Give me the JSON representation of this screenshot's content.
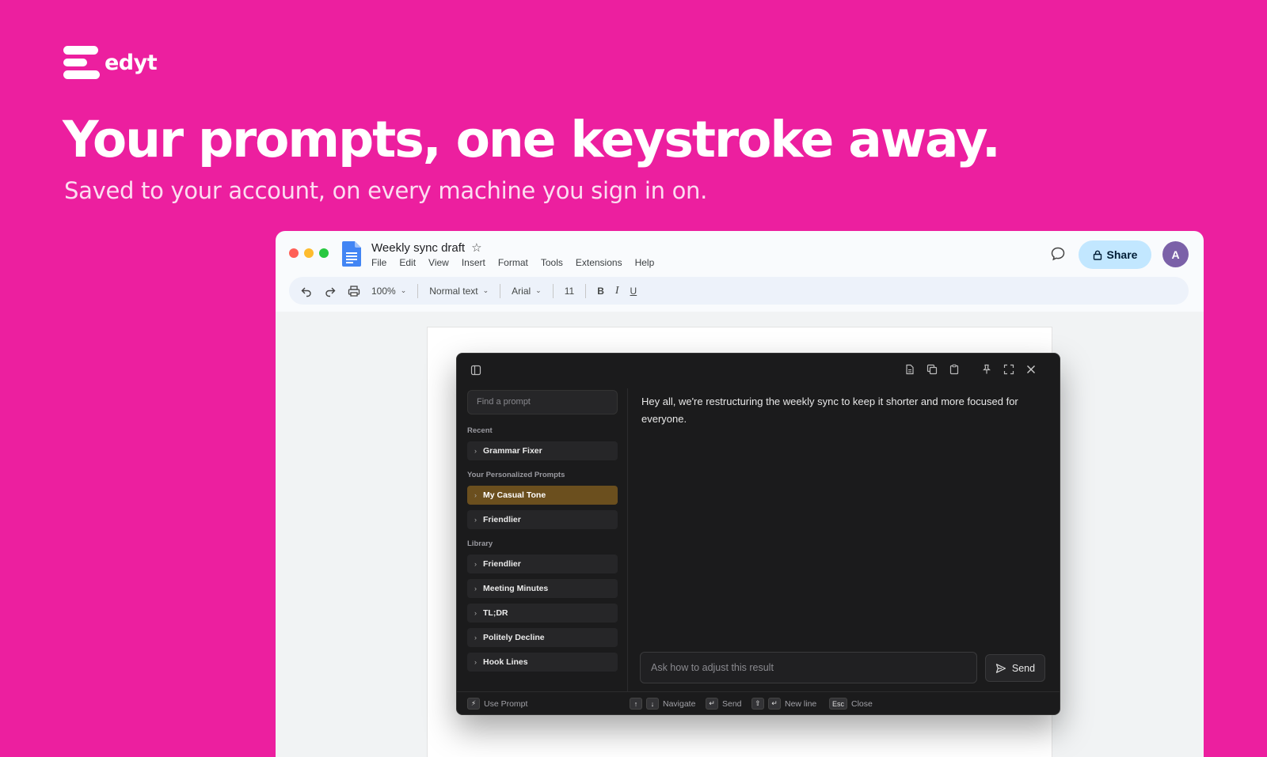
{
  "brand": {
    "name": "edyt"
  },
  "hero": {
    "headline": "Your prompts, one keystroke away.",
    "subhead": "Saved to your account, on every machine you sign in on."
  },
  "docs": {
    "title": "Weekly sync draft",
    "menu": [
      "File",
      "Edit",
      "View",
      "Insert",
      "Format",
      "Tools",
      "Extensions",
      "Help"
    ],
    "share_label": "Share",
    "avatar_initial": "A",
    "toolbar": {
      "zoom": "100%",
      "style": "Normal text",
      "font": "Arial",
      "size": "11",
      "bold": "B",
      "italic": "I",
      "underline": "U"
    },
    "colors": {
      "share_bg": "#c2e7ff",
      "avatar": "#7b61a8"
    }
  },
  "panel": {
    "search_placeholder": "Find a prompt",
    "sections": {
      "recent": "Recent",
      "personalized": "Your Personalized Prompts",
      "library": "Library"
    },
    "recent_items": [
      "Grammar Fixer"
    ],
    "personalized_items": [
      "My Casual Tone",
      "Friendlier"
    ],
    "library_items": [
      "Friendlier",
      "Meeting Minutes",
      "TL;DR",
      "Politely Decline",
      "Hook Lines"
    ],
    "message": "Hey all, we're restructuring the weekly sync to keep it shorter and more focused for everyone.",
    "ask_placeholder": "Ask how to adjust this result",
    "send_label": "Send",
    "footer": {
      "use_prompt": "Use Prompt",
      "navigate": "Navigate",
      "send": "Send",
      "new_line": "New line",
      "esc_key": "Esc",
      "close": "Close"
    },
    "colors": {
      "bg": "#1b1b1c",
      "active_item": "#6b4f1e"
    }
  },
  "colors": {
    "background": "#ec1f9f"
  }
}
